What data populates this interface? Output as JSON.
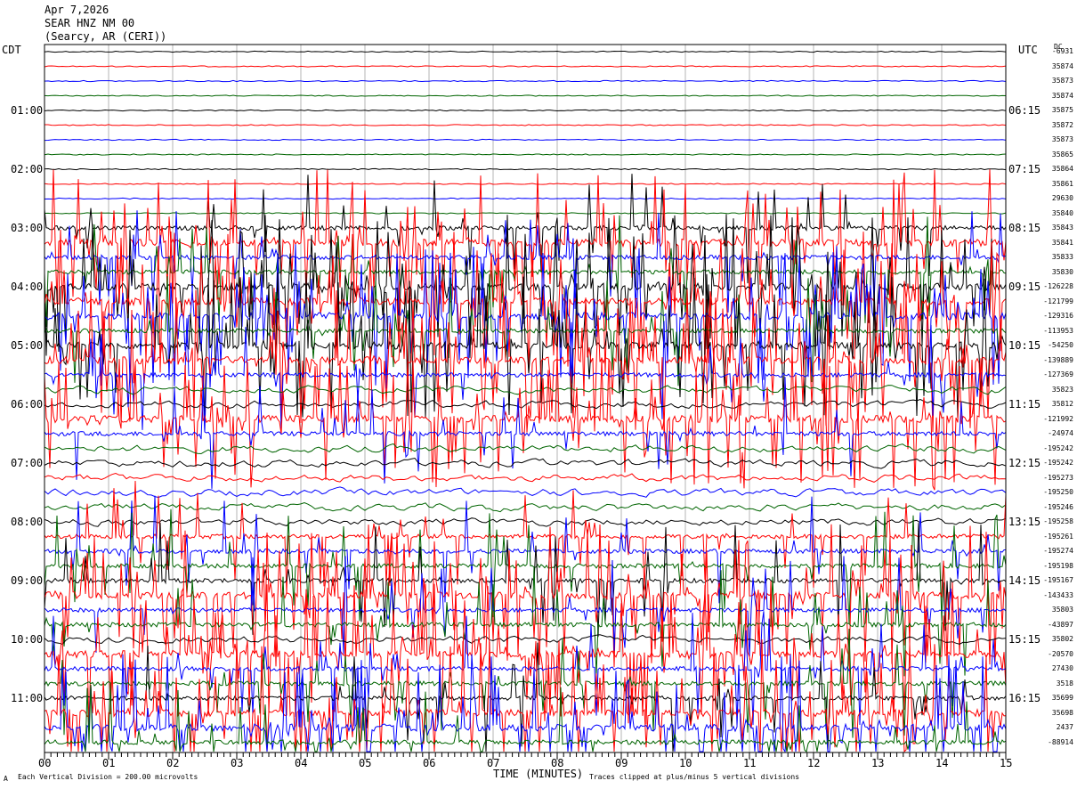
{
  "header": {
    "date": "Apr 7,2026",
    "station": "SEAR HNZ NM 00",
    "location": "(Searcy, AR (CERI))"
  },
  "left_axis_title": "CDT",
  "right_axis_title": "UTC",
  "dc_title": "DC",
  "xlabel": "TIME (MINUTES)",
  "footer_left": "Each Vertical Division = 200.00 microvolts",
  "footer_right": "Traces clipped at plus/minus 5 vertical divisions",
  "corner_mark": "A",
  "colors": {
    "black": "#000000",
    "red": "#ff0000",
    "blue": "#0000ff",
    "green": "#006400",
    "grid": "#b4b4b4"
  },
  "chart_data": {
    "type": "line",
    "title": "SEAR HNZ NM 00",
    "xlabel": "TIME (MINUTES)",
    "xlim": [
      0,
      15
    ],
    "x_ticks": [
      "00",
      "01",
      "02",
      "03",
      "04",
      "05",
      "06",
      "07",
      "08",
      "09",
      "10",
      "11",
      "12",
      "13",
      "14",
      "15"
    ],
    "left_ticks": [
      "01:00",
      "02:00",
      "03:00",
      "04:00",
      "05:00",
      "06:00",
      "07:00",
      "08:00",
      "09:00",
      "10:00",
      "11:00"
    ],
    "right_ticks": [
      "06:15",
      "07:15",
      "08:15",
      "09:15",
      "10:15",
      "11:15",
      "12:15",
      "13:15",
      "14:15",
      "15:15",
      "16:15"
    ],
    "series_color_cycle": [
      "red",
      "blue",
      "green",
      "black"
    ],
    "traces": [
      {
        "dc": "-6931",
        "color": "black",
        "activity": 0
      },
      {
        "dc": "35874",
        "color": "red",
        "activity": 0
      },
      {
        "dc": "35873",
        "color": "blue",
        "activity": 0
      },
      {
        "dc": "35874",
        "color": "green",
        "activity": 0
      },
      {
        "dc": "35875",
        "color": "black",
        "activity": 0
      },
      {
        "dc": "35872",
        "color": "red",
        "activity": 0
      },
      {
        "dc": "35873",
        "color": "blue",
        "activity": 0
      },
      {
        "dc": "35865",
        "color": "green",
        "activity": 0
      },
      {
        "dc": "35864",
        "color": "black",
        "activity": 0
      },
      {
        "dc": "35861",
        "color": "red",
        "activity": 0
      },
      {
        "dc": "29630",
        "color": "blue",
        "activity": 0
      },
      {
        "dc": "35840",
        "color": "green",
        "activity": 0
      },
      {
        "dc": "35843",
        "color": "black",
        "activity": 2
      },
      {
        "dc": "35841",
        "color": "red",
        "activity": 3
      },
      {
        "dc": "35833",
        "color": "blue",
        "activity": 2
      },
      {
        "dc": "35830",
        "color": "green",
        "activity": 2
      },
      {
        "dc": "-126228",
        "color": "black",
        "activity": 3
      },
      {
        "dc": "-121799",
        "color": "red",
        "activity": 3
      },
      {
        "dc": "-129316",
        "color": "blue",
        "activity": 3
      },
      {
        "dc": "-113953",
        "color": "green",
        "activity": 2
      },
      {
        "dc": "-54250",
        "color": "black",
        "activity": 3
      },
      {
        "dc": "-139889",
        "color": "red",
        "activity": 3
      },
      {
        "dc": "-127369",
        "color": "blue",
        "activity": 2
      },
      {
        "dc": "35823",
        "color": "green",
        "activity": 1
      },
      {
        "dc": "35812",
        "color": "black",
        "activity": 1
      },
      {
        "dc": "-121992",
        "color": "red",
        "activity": 3
      },
      {
        "dc": "-24974",
        "color": "blue",
        "activity": 2
      },
      {
        "dc": "-195242",
        "color": "green",
        "activity": 1
      },
      {
        "dc": "-195242",
        "color": "black",
        "activity": 1
      },
      {
        "dc": "-195273",
        "color": "red",
        "activity": 1
      },
      {
        "dc": "-195250",
        "color": "blue",
        "activity": 1
      },
      {
        "dc": "-195246",
        "color": "green",
        "activity": 1
      },
      {
        "dc": "-195258",
        "color": "black",
        "activity": 1
      },
      {
        "dc": "-195261",
        "color": "red",
        "activity": 2
      },
      {
        "dc": "-195274",
        "color": "blue",
        "activity": 2
      },
      {
        "dc": "-195198",
        "color": "green",
        "activity": 2
      },
      {
        "dc": "-195167",
        "color": "black",
        "activity": 2
      },
      {
        "dc": "-143433",
        "color": "red",
        "activity": 3
      },
      {
        "dc": "35803",
        "color": "blue",
        "activity": 2
      },
      {
        "dc": "-43897",
        "color": "green",
        "activity": 2
      },
      {
        "dc": "35802",
        "color": "black",
        "activity": 1
      },
      {
        "dc": "-20570",
        "color": "red",
        "activity": 3
      },
      {
        "dc": "27430",
        "color": "blue",
        "activity": 2
      },
      {
        "dc": "3518",
        "color": "green",
        "activity": 2
      },
      {
        "dc": "35699",
        "color": "black",
        "activity": 2
      },
      {
        "dc": "35698",
        "color": "red",
        "activity": 3
      },
      {
        "dc": "2437",
        "color": "blue",
        "activity": 3
      },
      {
        "dc": "-88914",
        "color": "green",
        "activity": 2
      }
    ]
  }
}
